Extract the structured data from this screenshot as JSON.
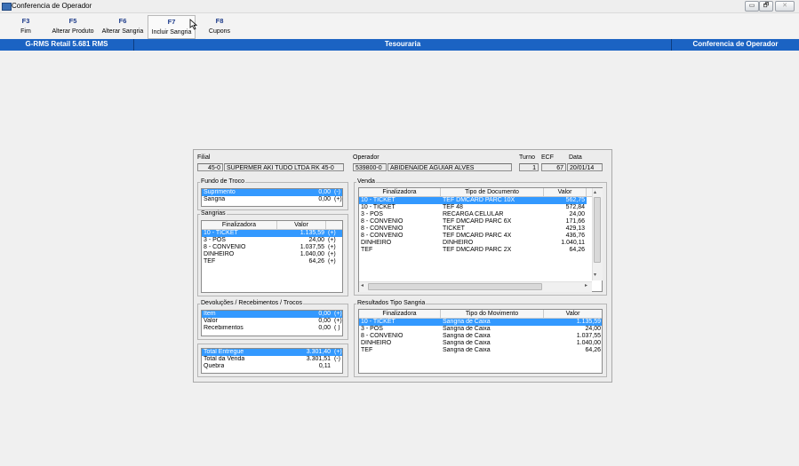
{
  "window": {
    "title": "Conferencia de Operador",
    "controls": {
      "minimize": "▭",
      "restore": "🗗",
      "close": "✕"
    }
  },
  "toolbar": [
    {
      "key": "F3",
      "label": "Fim"
    },
    {
      "key": "F5",
      "label": "Alterar Produto"
    },
    {
      "key": "F6",
      "label": "Alterar Sangria"
    },
    {
      "key": "F7",
      "label": "Incluir Sangria"
    },
    {
      "key": "F8",
      "label": "Cupons"
    }
  ],
  "header": {
    "app": "G-RMS Retail 5.681 RMS",
    "module": "Tesouraria",
    "screen": "Conferencia de Operador"
  },
  "top": {
    "filial_label": "Filial",
    "filial_code": "45-0",
    "filial_name": "SUPERMER AKI TUDO LTDA RK 45-0",
    "operador_label": "Operador",
    "operador_code": "539800-0",
    "operador_name": "ABIDENAIDE AGUIAR ALVES",
    "turno_label": "Turno",
    "turno": "1",
    "ecf_label": "ECF",
    "ecf": "67",
    "data_label": "Data",
    "data": "20/01/14"
  },
  "fundo": {
    "title": "Fundo de Troco",
    "rows": [
      {
        "name": "Suprimento",
        "value": "0,00",
        "sign": "(-)"
      },
      {
        "name": "Sangria",
        "value": "0,00",
        "sign": "(+)"
      }
    ]
  },
  "sangrias": {
    "title": "Sangrias",
    "headers": [
      "Finalizadora",
      "Valor"
    ],
    "rows": [
      {
        "name": "10 - TICKET",
        "value": "1.135,59",
        "sign": "(+)"
      },
      {
        "name": "3 - POS",
        "value": "24,00",
        "sign": "(+)"
      },
      {
        "name": "8 - CONVENIO",
        "value": "1.037,55",
        "sign": "(+)"
      },
      {
        "name": "DINHEIRO",
        "value": "1.040,00",
        "sign": "(+)"
      },
      {
        "name": "TEF",
        "value": "64,26",
        "sign": "(+)"
      }
    ]
  },
  "devolucoes": {
    "title": "Devoluções / Recebimentos / Trocos",
    "rows": [
      {
        "name": "Item",
        "value": "0,00",
        "sign": "(+)"
      },
      {
        "name": "Valor",
        "value": "0,00",
        "sign": "(+)"
      },
      {
        "name": "Recebimentos",
        "value": "0,00",
        "sign": "( )"
      }
    ]
  },
  "totais": {
    "rows": [
      {
        "name": "Total Entregue",
        "value": "3.301,40",
        "sign": "(+)"
      },
      {
        "name": "Total da Venda",
        "value": "3.301,51",
        "sign": "(-)"
      },
      {
        "name": "Quebra",
        "value": "0,11",
        "sign": ""
      }
    ]
  },
  "venda": {
    "title": "Venda",
    "headers": [
      "Finalizadora",
      "Tipo de Documento",
      "Valor"
    ],
    "rows": [
      {
        "fin": "10 - TICKET",
        "tipo": "TEF DMCARD PARC 10X",
        "valor": "562,75"
      },
      {
        "fin": "10 - TICKET",
        "tipo": "TEF 48",
        "valor": "572,84"
      },
      {
        "fin": "3 - POS",
        "tipo": "RECARGA CELULAR",
        "valor": "24,00"
      },
      {
        "fin": "8 - CONVENIO",
        "tipo": "TEF DMCARD PARC 6X",
        "valor": "171,66"
      },
      {
        "fin": "8 - CONVENIO",
        "tipo": "TICKET",
        "valor": "429,13"
      },
      {
        "fin": "8 - CONVENIO",
        "tipo": "TEF DMCARD PARC 4X",
        "valor": "436,76"
      },
      {
        "fin": "DINHEIRO",
        "tipo": "DINHEIRO",
        "valor": "1.040,11"
      },
      {
        "fin": "TEF",
        "tipo": "TEF DMCARD PARC 2X",
        "valor": "64,26"
      }
    ]
  },
  "resultados": {
    "title": "Resultados Tipo Sangria",
    "headers": [
      "Finalizadora",
      "Tipo do Movimento",
      "Valor"
    ],
    "rows": [
      {
        "fin": "10 - TICKET",
        "tipo": "Sangria de Caixa",
        "valor": "1.135,59"
      },
      {
        "fin": "3 - POS",
        "tipo": "Sangria de Caixa",
        "valor": "24,00"
      },
      {
        "fin": "8 - CONVENIO",
        "tipo": "Sangria de Caixa",
        "valor": "1.037,55"
      },
      {
        "fin": "DINHEIRO",
        "tipo": "Sangria de Caixa",
        "valor": "1.040,00"
      },
      {
        "fin": "TEF",
        "tipo": "Sangria de Caixa",
        "valor": "64,26"
      }
    ]
  },
  "colors": {
    "header_blue": "#1b63c3",
    "selection": "#3399ff",
    "key_text": "#1d3b8a"
  }
}
